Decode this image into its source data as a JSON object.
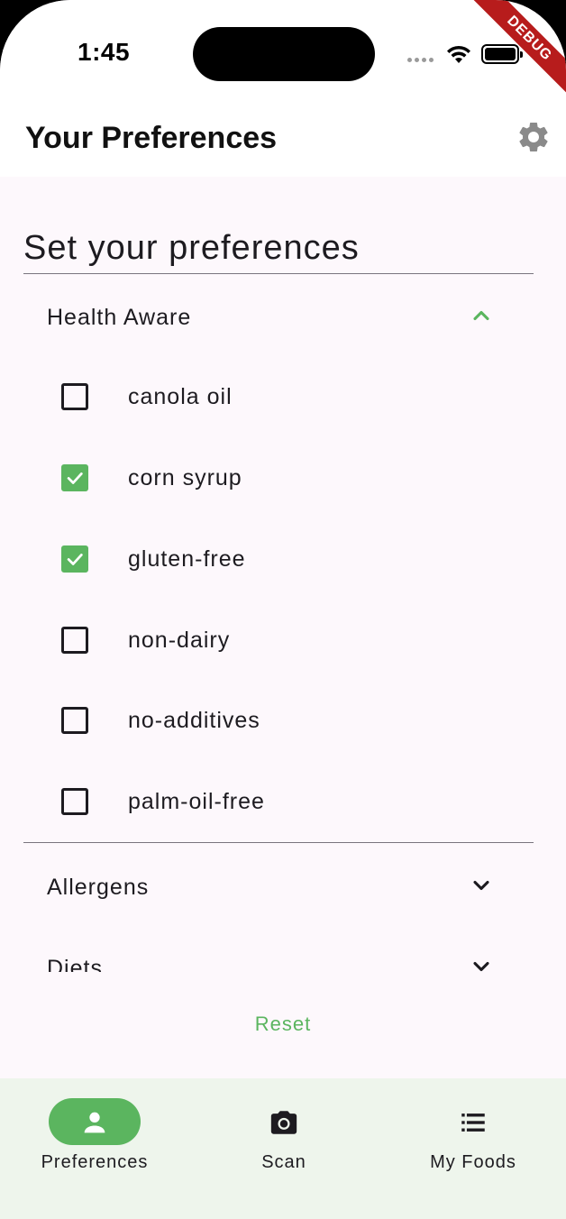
{
  "status_bar": {
    "time": "1:45",
    "debug_label": "DEBUG"
  },
  "app_bar": {
    "title": "Your Preferences",
    "settings_icon": "gear-icon"
  },
  "content": {
    "heading": "Set your preferences",
    "groups": [
      {
        "label": "Health Aware",
        "expanded": true,
        "items": [
          {
            "label": "canola oil",
            "checked": false
          },
          {
            "label": "corn syrup",
            "checked": true
          },
          {
            "label": "gluten-free",
            "checked": true
          },
          {
            "label": "non-dairy",
            "checked": false
          },
          {
            "label": "no-additives",
            "checked": false
          },
          {
            "label": "palm-oil-free",
            "checked": false
          }
        ]
      },
      {
        "label": "Allergens",
        "expanded": false
      },
      {
        "label": "Diets",
        "expanded": false
      }
    ],
    "reset_label": "Reset"
  },
  "bottom_nav": {
    "items": [
      {
        "label": "Preferences",
        "icon": "person-icon",
        "active": true
      },
      {
        "label": "Scan",
        "icon": "camera-icon",
        "active": false
      },
      {
        "label": "My Foods",
        "icon": "list-icon",
        "active": false
      }
    ]
  },
  "colors": {
    "accent": "#5bb55f",
    "background": "#fdf8fc",
    "nav_background": "#eef5ec",
    "debug": "#b71c1c"
  }
}
